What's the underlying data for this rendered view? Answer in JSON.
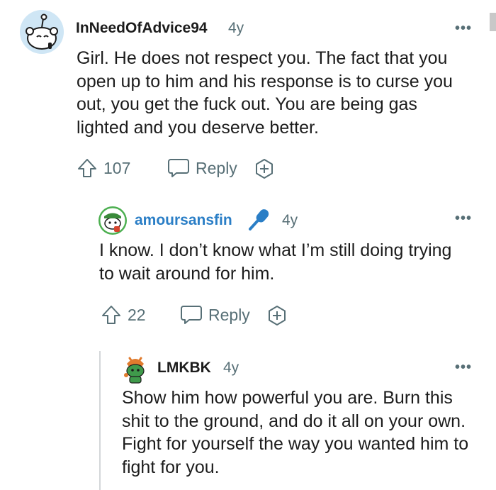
{
  "comments": [
    {
      "username": "InNeedOfAdvice94",
      "age": "4y",
      "body": "Girl. He does not respect you. The fact that you open up to him and his response is to curse you out, you get the fuck out. You are being gas lighted and you deserve better.",
      "votes": "107",
      "reply_label": "Reply",
      "more_label": "•••"
    },
    {
      "username": "amoursansfin",
      "age": "4y",
      "body": "I know. I don’t know what I’m still doing trying to wait around for him.",
      "votes": "22",
      "reply_label": "Reply",
      "more_label": "•••",
      "username_color": "#2a7ec6"
    },
    {
      "username": "LMKBK",
      "age": "4y",
      "body": "Show him how powerful you are. Burn this shit to the ground, and do it all on your own. Fight for yourself the way you wanted him to fight for you.",
      "more_label": "•••"
    }
  ],
  "colors": {
    "accent_blue": "#2a7ec6",
    "meta_gray": "#576f76",
    "thread_line": "#d4d7d9"
  },
  "icons": [
    "upvote-icon",
    "comment-bubble-icon",
    "award-icon",
    "microphone-icon",
    "more-options-icon"
  ]
}
